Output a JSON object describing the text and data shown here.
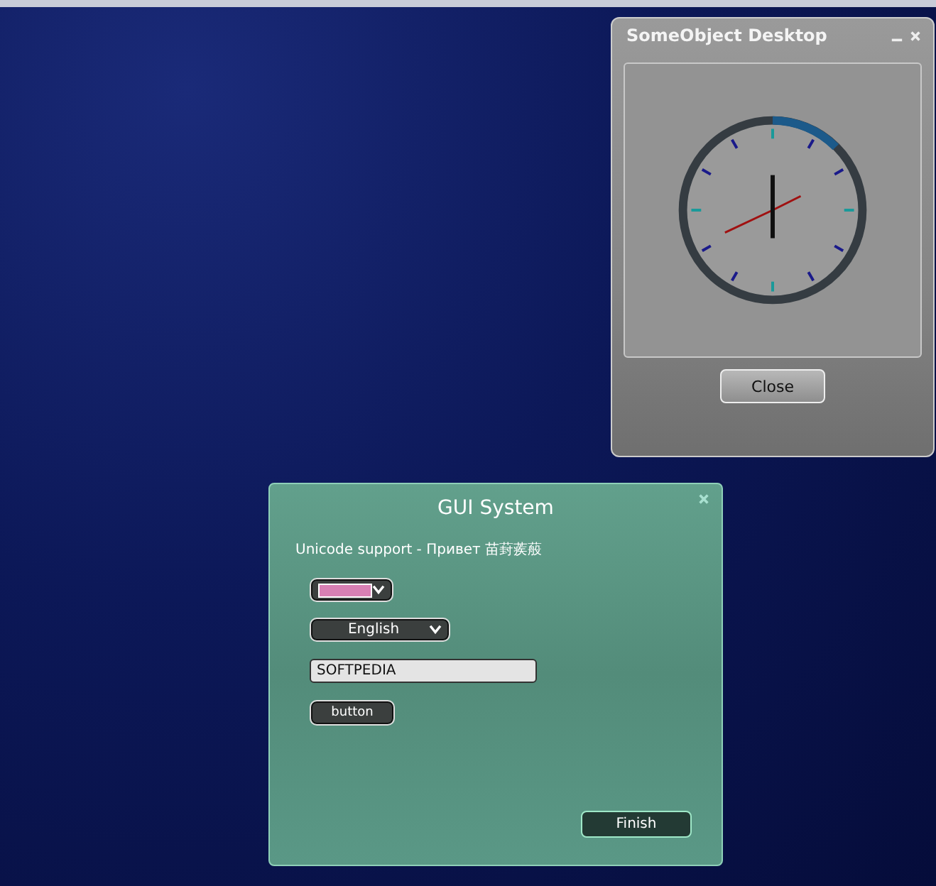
{
  "clock_window": {
    "title": "SomeObject Desktop",
    "close_button": "Close"
  },
  "gui_window": {
    "title": "GUI System",
    "unicode_label": "Unicode support - Привет 苗葑蒺蒰",
    "color_dropdown": {
      "color": "#d880b4"
    },
    "language_dropdown": {
      "value": "English"
    },
    "text_field": {
      "value": "SOFTPEDIA"
    },
    "button": "button",
    "finish_button": "Finish"
  }
}
